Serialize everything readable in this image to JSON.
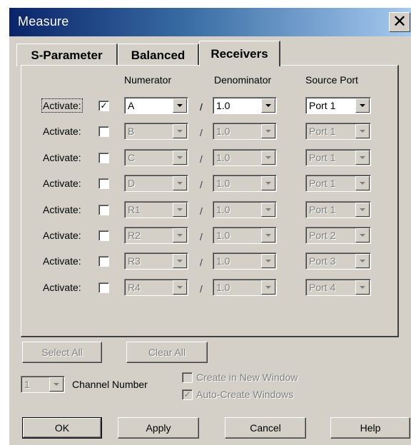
{
  "window": {
    "title": "Measure"
  },
  "icons": {
    "close": "close-icon",
    "dropdown": "chevron-down-icon",
    "check": "check-icon"
  },
  "tabs": [
    {
      "label": "S-Parameter",
      "active": false
    },
    {
      "label": "Balanced",
      "active": false
    },
    {
      "label": "Receivers",
      "active": true
    }
  ],
  "columns": {
    "numerator": "Numerator",
    "denominator": "Denominator",
    "source_port": "Source Port"
  },
  "separator": "/",
  "rows": [
    {
      "label": "Activate:",
      "checked": true,
      "numerator": "A",
      "denominator": "1.0",
      "source_port": "Port 1"
    },
    {
      "label": "Activate:",
      "checked": false,
      "numerator": "B",
      "denominator": "1.0",
      "source_port": "Port 1"
    },
    {
      "label": "Activate:",
      "checked": false,
      "numerator": "C",
      "denominator": "1.0",
      "source_port": "Port 1"
    },
    {
      "label": "Activate:",
      "checked": false,
      "numerator": "D",
      "denominator": "1.0",
      "source_port": "Port 1"
    },
    {
      "label": "Activate:",
      "checked": false,
      "numerator": "R1",
      "denominator": "1.0",
      "source_port": "Port 1"
    },
    {
      "label": "Activate:",
      "checked": false,
      "numerator": "R2",
      "denominator": "1.0",
      "source_port": "Port 2"
    },
    {
      "label": "Activate:",
      "checked": false,
      "numerator": "R3",
      "denominator": "1.0",
      "source_port": "Port 3"
    },
    {
      "label": "Activate:",
      "checked": false,
      "numerator": "R4",
      "denominator": "1.0",
      "source_port": "Port 4"
    }
  ],
  "select_all": "Select All",
  "clear_all": "Clear All",
  "channel": {
    "value": "1",
    "label": "Channel Number"
  },
  "create_new_window": {
    "label": "Create in New Window",
    "checked": false
  },
  "auto_create_windows": {
    "label": "Auto-Create Windows",
    "checked": true
  },
  "buttons": {
    "ok": "OK",
    "apply": "Apply",
    "cancel": "Cancel",
    "help": "Help"
  }
}
